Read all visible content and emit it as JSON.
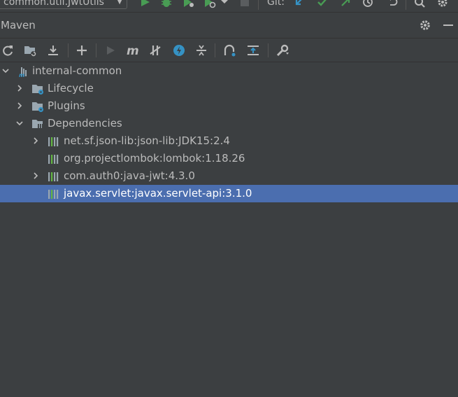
{
  "topbar": {
    "run_config": "common.util.JwtUtils",
    "git_label": "Git:"
  },
  "header": {
    "title": "Maven"
  },
  "toolbar": {
    "tools": [
      "reload-icon",
      "reimport-folder-icon",
      "download-icon",
      "add-icon",
      "run-icon",
      "maven-goal-icon",
      "skip-tests-icon",
      "offline-icon",
      "collapse-icon",
      "analyze-icon",
      "show-dependencies-icon",
      "settings-wrench-icon"
    ]
  },
  "tree": {
    "root": "internal-common",
    "lifecycle": "Lifecycle",
    "plugins": "Plugins",
    "dependencies": "Dependencies",
    "deps": [
      "net.sf.json-lib:json-lib:JDK15:2.4",
      "org.projectlombok:lombok:1.18.26",
      "com.auth0:java-jwt:4.3.0",
      "javax.servlet:javax.servlet-api:3.1.0"
    ],
    "selected": "javax.servlet:javax.servlet-api:3.1.0"
  },
  "colors": {
    "background": "#3c3f41",
    "selection": "#4b6eaf",
    "text": "#bbbbbb",
    "run_green": "#499c54",
    "accent_blue": "#3592c4"
  }
}
